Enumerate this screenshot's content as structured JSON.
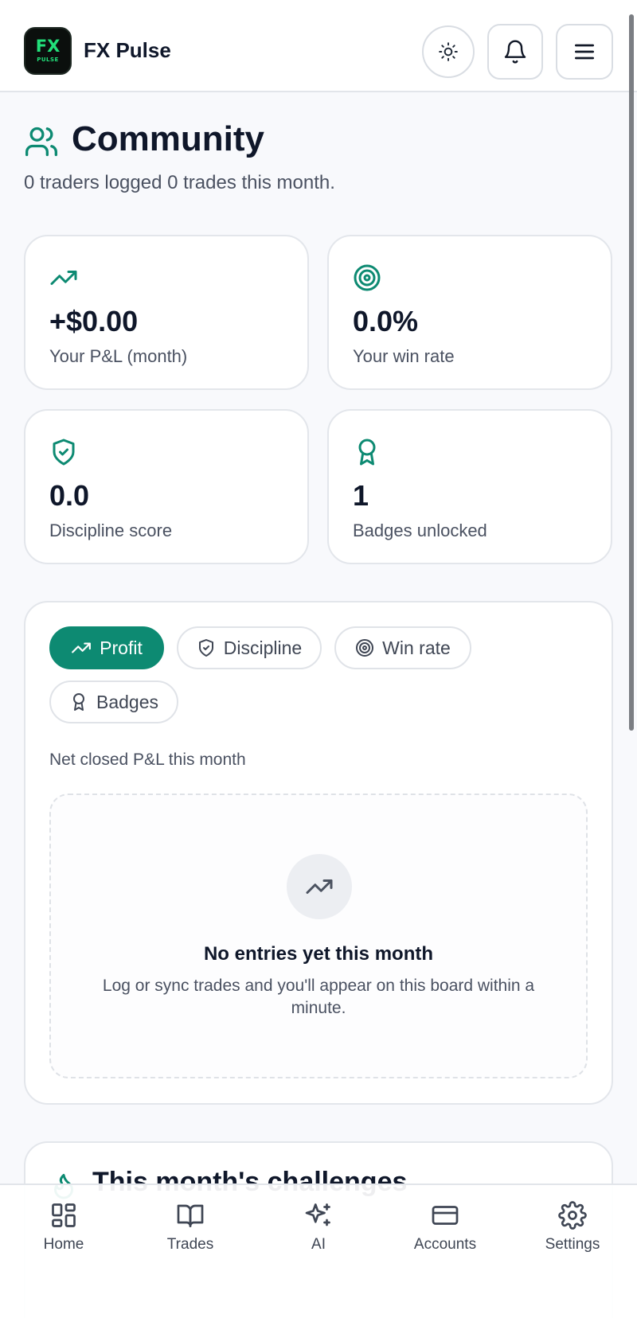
{
  "app": {
    "name": "FX Pulse",
    "logo_text": "FX",
    "logo_subtext": "PULSE"
  },
  "header": {
    "theme_icon": "sun-icon",
    "notifications_icon": "bell-icon",
    "menu_icon": "hamburger-icon"
  },
  "page": {
    "icon": "users-icon",
    "title": "Community",
    "subtitle": "0 traders logged 0 trades this month."
  },
  "stats": [
    {
      "icon": "trending-up-icon",
      "value": "+$0.00",
      "label": "Your P&L (month)"
    },
    {
      "icon": "target-icon",
      "value": "0.0%",
      "label": "Your win rate"
    },
    {
      "icon": "shield-check-icon",
      "value": "0.0",
      "label": "Discipline score"
    },
    {
      "icon": "award-icon",
      "value": "1",
      "label": "Badges unlocked"
    }
  ],
  "leaderboard": {
    "tabs": [
      {
        "label": "Profit",
        "icon": "trending-up-icon",
        "active": true
      },
      {
        "label": "Discipline",
        "icon": "shield-check-icon",
        "active": false
      },
      {
        "label": "Win rate",
        "icon": "target-icon",
        "active": false
      },
      {
        "label": "Badges",
        "icon": "award-icon",
        "active": false
      }
    ],
    "caption": "Net closed P&L this month",
    "empty": {
      "icon": "trending-up-icon",
      "title": "No entries yet this month",
      "text": "Log or sync trades and you'll appear on this board within a minute."
    }
  },
  "challenges": {
    "icon": "flame-icon",
    "title": "This month's challenges"
  },
  "nav": [
    {
      "label": "Home",
      "icon": "grid-icon"
    },
    {
      "label": "Trades",
      "icon": "book-icon"
    },
    {
      "label": "AI",
      "icon": "sparkles-icon"
    },
    {
      "label": "Accounts",
      "icon": "credit-card-icon"
    },
    {
      "label": "Settings",
      "icon": "gear-icon"
    }
  ],
  "colors": {
    "accent": "#0d8a72",
    "logo_green": "#22e07a",
    "text": "#0f172a",
    "muted": "#4a5161",
    "border": "#e3e6eb",
    "background": "#f8f9fc"
  }
}
